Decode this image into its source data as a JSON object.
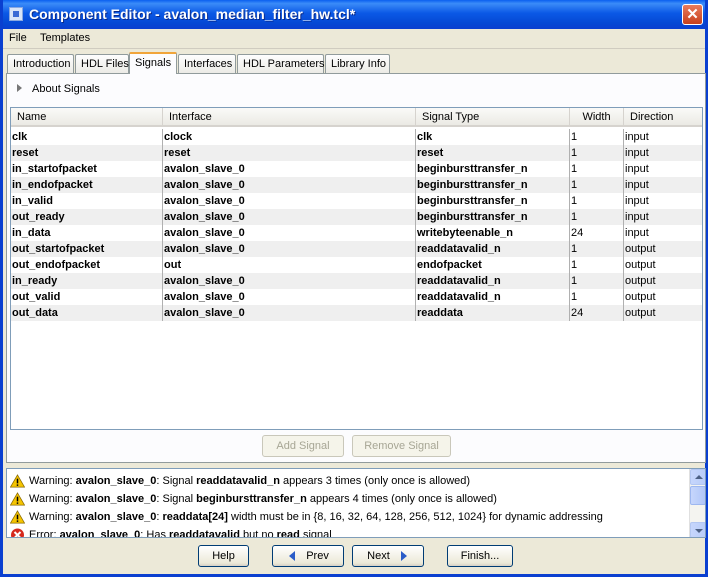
{
  "window": {
    "title": "Component Editor - avalon_median_filter_hw.tcl*",
    "close": "✕"
  },
  "menu": [
    "File",
    "Templates"
  ],
  "tabs": [
    "Introduction",
    "HDL Files",
    "Signals",
    "Interfaces",
    "HDL Parameters",
    "Library Info"
  ],
  "active_tab": "Signals",
  "about": {
    "label": "About Signals"
  },
  "table": {
    "columns": [
      "Name",
      "Interface",
      "Signal Type",
      "Width",
      "Direction"
    ],
    "rows": [
      [
        "clk",
        "clock",
        "clk",
        "1",
        "input"
      ],
      [
        "reset",
        "reset",
        "reset",
        "1",
        "input"
      ],
      [
        "in_startofpacket",
        "avalon_slave_0",
        "beginbursttransfer_n",
        "1",
        "input"
      ],
      [
        "in_endofpacket",
        "avalon_slave_0",
        "beginbursttransfer_n",
        "1",
        "input"
      ],
      [
        "in_valid",
        "avalon_slave_0",
        "beginbursttransfer_n",
        "1",
        "input"
      ],
      [
        "out_ready",
        "avalon_slave_0",
        "beginbursttransfer_n",
        "1",
        "input"
      ],
      [
        "in_data",
        "avalon_slave_0",
        "writebyteenable_n",
        "24",
        "input"
      ],
      [
        "out_startofpacket",
        "avalon_slave_0",
        "readdatavalid_n",
        "1",
        "output"
      ],
      [
        "out_endofpacket",
        "out",
        "endofpacket",
        "1",
        "output"
      ],
      [
        "in_ready",
        "avalon_slave_0",
        "readdatavalid_n",
        "1",
        "output"
      ],
      [
        "out_valid",
        "avalon_slave_0",
        "readdatavalid_n",
        "1",
        "output"
      ],
      [
        "out_data",
        "avalon_slave_0",
        "readdata",
        "24",
        "output"
      ]
    ]
  },
  "buttons": {
    "add_signal": "Add Signal",
    "remove_signal": "Remove Signal"
  },
  "messages": [
    {
      "type": "warning",
      "prefix": "Warning: ",
      "b1": "avalon_slave_0",
      "t1": ": Signal ",
      "b2": "readdatavalid_n",
      "t2": " appears 3 times (only once is allowed)"
    },
    {
      "type": "warning",
      "prefix": "Warning: ",
      "b1": "avalon_slave_0",
      "t1": ": Signal ",
      "b2": "beginbursttransfer_n",
      "t2": " appears 4 times (only once is allowed)"
    },
    {
      "type": "warning",
      "prefix": "Warning: ",
      "b1": "avalon_slave_0",
      "t1": ": ",
      "b2": "readdata[24]",
      "t2": " width must be in {8, 16, 32, 64, 128, 256, 512, 1024} for dynamic addressing"
    },
    {
      "type": "error",
      "prefix": "Error: ",
      "b1": "avalon_slave_0",
      "t1": ": Has ",
      "b2": "readdatavalid",
      "t2": " but no ",
      "b3": "read",
      "t3": " signal"
    }
  ],
  "footer": {
    "help": "Help",
    "prev": "Prev",
    "next": "Next",
    "finish": "Finish..."
  },
  "colors": {
    "title_bar": "#0a5ff0",
    "active_tab_accent": "#f1a53a",
    "button_border": "#003c74",
    "warning": "#f5c400",
    "error": "#d62a1e"
  }
}
